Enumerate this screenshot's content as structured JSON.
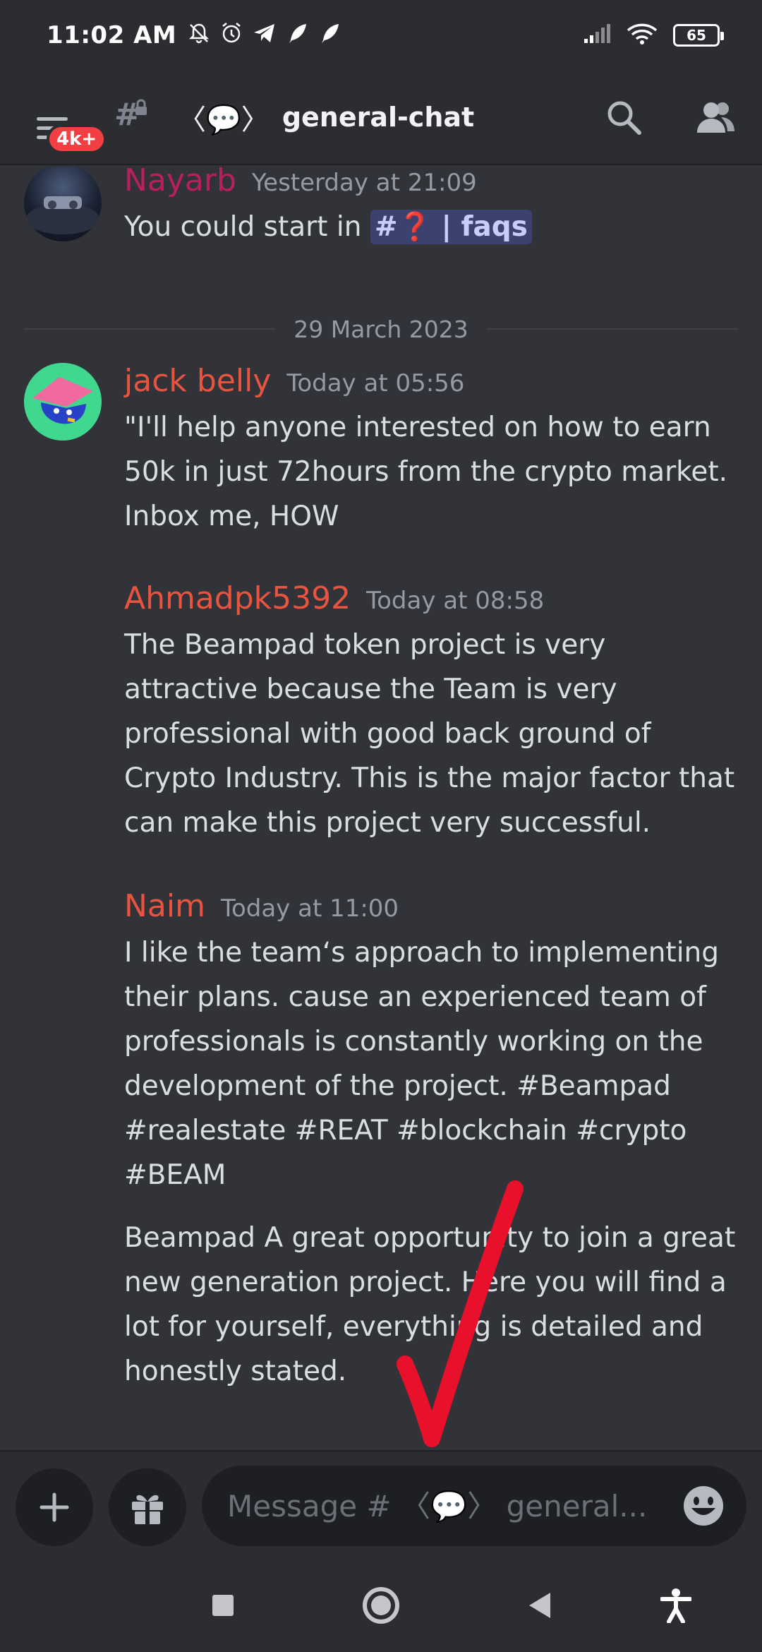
{
  "status_bar": {
    "time": "11:02 AM",
    "left_icons": [
      "mute-icon",
      "alarm-icon",
      "telegram-icon",
      "feather-icon",
      "feather-icon"
    ],
    "battery": "65"
  },
  "header": {
    "badge": "4k+",
    "channel_emoji": "〈💬〉",
    "channel_name": "general-chat"
  },
  "messages": [
    {
      "author": "Nayarb",
      "author_color": "#b8205b",
      "timestamp": "Yesterday at 21:09",
      "text_prefix": "You could start in ",
      "mention": "#❓ | faqs"
    },
    {
      "author": "jack belly",
      "author_color": "#e8543f",
      "timestamp": "Today at 05:56",
      "text": "\"I'll help anyone interested on how to earn 50k in just 72hours  from the crypto market. Inbox me, HOW"
    },
    {
      "author": "Ahmadpk5392",
      "author_color": "#e8543f",
      "timestamp": "Today at 08:58",
      "text": "The Beampad token project is very attractive because the Team is very professional with good back ground of Crypto Industry. This is the major factor that can make this project very successful."
    },
    {
      "author": "Naim",
      "author_color": "#e8543f",
      "timestamp": "Today at 11:00",
      "text": "I like the team‘s approach to implementing their plans.  cause an experienced team of professionals is constantly working on the development of the project.  #Beampad #realestate #REAT #blockchain #crypto #BEAM",
      "text2": "Beampad A great opportunity to join a great new generation project. Here you will find a lot for yourself, everything is detailed and honestly stated."
    }
  ],
  "date_divider": "29 March 2023",
  "composer": {
    "placeholder": "Message # 〈💬〉 general..."
  },
  "colors": {
    "background": "#313338",
    "panel": "#2b2d31",
    "input": "#1e1f22",
    "annotation": "#e8102a"
  }
}
